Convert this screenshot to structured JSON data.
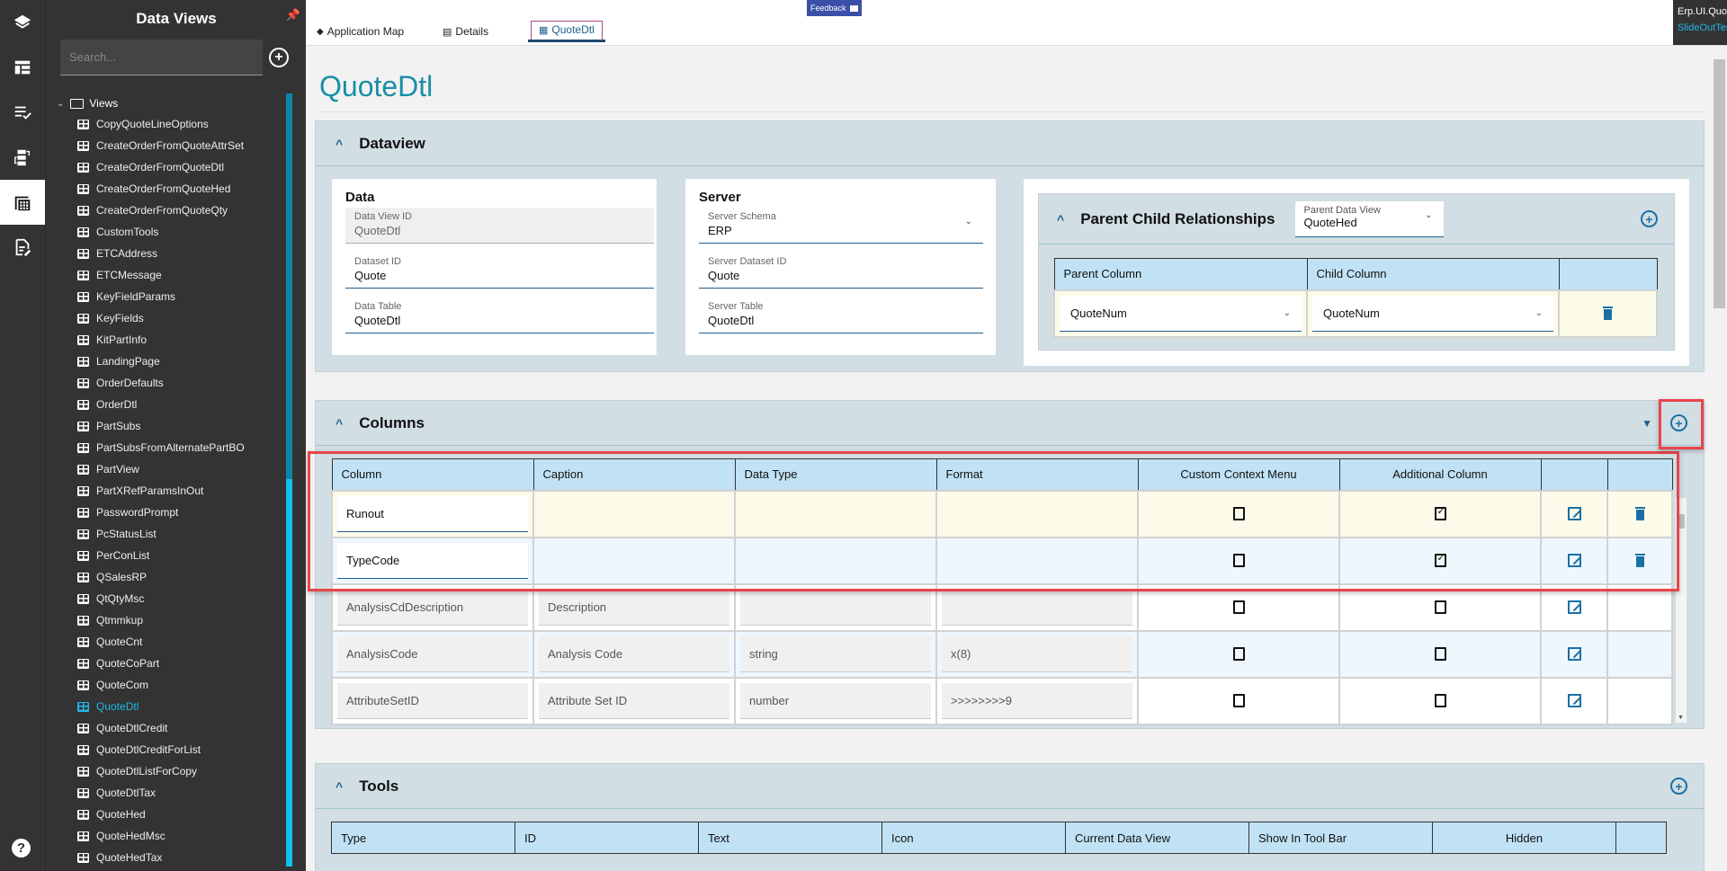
{
  "rail": {
    "items": [
      {
        "icon": "layers-icon"
      },
      {
        "icon": "layout-icon"
      },
      {
        "icon": "checklist-icon"
      },
      {
        "icon": "workflow-icon"
      },
      {
        "icon": "dataview-icon",
        "active": true
      },
      {
        "icon": "edit-document-icon"
      }
    ],
    "help_icon": "?"
  },
  "panel": {
    "title": "Data Views",
    "search_placeholder": "Search...",
    "add_icon": "+",
    "tree_root": "Views",
    "items": [
      "CopyQuoteLineOptions",
      "CreateOrderFromQuoteAttrSet",
      "CreateOrderFromQuoteDtl",
      "CreateOrderFromQuoteHed",
      "CreateOrderFromQuoteQty",
      "CustomTools",
      "ETCAddress",
      "ETCMessage",
      "KeyFieldParams",
      "KeyFields",
      "KitPartInfo",
      "LandingPage",
      "OrderDefaults",
      "OrderDtl",
      "PartSubs",
      "PartSubsFromAlternatePartBO",
      "PartView",
      "PartXRefParamsInOut",
      "PasswordPrompt",
      "PcStatusList",
      "PerConList",
      "QSalesRP",
      "QtQtyMsc",
      "Qtmmkup",
      "QuoteCnt",
      "QuoteCoPart",
      "QuoteCom",
      "QuoteDtl",
      "QuoteDtlCredit",
      "QuoteDtlCreditForList",
      "QuoteDtlListForCopy",
      "QuoteDtlTax",
      "QuoteHed",
      "QuoteHedMsc",
      "QuoteHedTax"
    ],
    "selected": "QuoteDtl"
  },
  "topbar": {
    "tabs": [
      {
        "label": "Application Map",
        "icon": "layers-icon"
      },
      {
        "label": "Details",
        "icon": "details-icon"
      },
      {
        "label": "QuoteDtl",
        "icon": "dataview-icon",
        "active": true
      }
    ],
    "feedback_label": "Feedback",
    "app_name": "Erp.UI.QuoteEntry",
    "layer_name": "SlideOutTest"
  },
  "page": {
    "title": "QuoteDtl"
  },
  "dataview": {
    "title": "Dataview",
    "data_card": {
      "title": "Data",
      "fields": [
        {
          "label": "Data View ID",
          "value": "QuoteDtl",
          "readonly": true
        },
        {
          "label": "Dataset ID",
          "value": "Quote"
        },
        {
          "label": "Data Table",
          "value": "QuoteDtl"
        }
      ]
    },
    "server_card": {
      "title": "Server",
      "fields": [
        {
          "label": "Server Schema",
          "value": "ERP",
          "dropdown": true
        },
        {
          "label": "Server Dataset ID",
          "value": "Quote"
        },
        {
          "label": "Server Table",
          "value": "QuoteDtl"
        }
      ]
    },
    "parent_child": {
      "title": "Parent Child Relationships",
      "parent_data_view_label": "Parent Data View",
      "parent_data_view_value": "QuoteHed",
      "headers": [
        "Parent Column",
        "Child Column",
        ""
      ],
      "rows": [
        {
          "parent": "QuoteNum",
          "child": "QuoteNum"
        }
      ]
    }
  },
  "columns": {
    "title": "Columns",
    "headers": [
      "Column",
      "Caption",
      "Data Type",
      "Format",
      "Custom Context Menu",
      "Additional Column",
      "",
      ""
    ],
    "rows": [
      {
        "column": "Runout",
        "caption": "",
        "data_type": "",
        "format": "",
        "custom_context_menu": false,
        "additional_column": true,
        "editable": true,
        "deletable": true
      },
      {
        "column": "TypeCode",
        "caption": "",
        "data_type": "",
        "format": "",
        "custom_context_menu": false,
        "additional_column": true,
        "editable": true,
        "deletable": true
      },
      {
        "column": "AnalysisCdDescription",
        "caption": "Description",
        "data_type": "",
        "format": "",
        "custom_context_menu": false,
        "additional_column": false,
        "editable": false,
        "deletable": false
      },
      {
        "column": "AnalysisCode",
        "caption": "Analysis Code",
        "data_type": "string",
        "format": "x(8)",
        "custom_context_menu": false,
        "additional_column": false,
        "editable": false,
        "deletable": false
      },
      {
        "column": "AttributeSetID",
        "caption": "Attribute Set ID",
        "data_type": "number",
        "format": ">>>>>>>>9",
        "custom_context_menu": false,
        "additional_column": false,
        "editable": false,
        "deletable": false
      }
    ]
  },
  "tools": {
    "title": "Tools",
    "headers": [
      "Type",
      "ID",
      "Text",
      "Icon",
      "Current Data View",
      "Show In Tool Bar",
      "Hidden",
      ""
    ]
  }
}
